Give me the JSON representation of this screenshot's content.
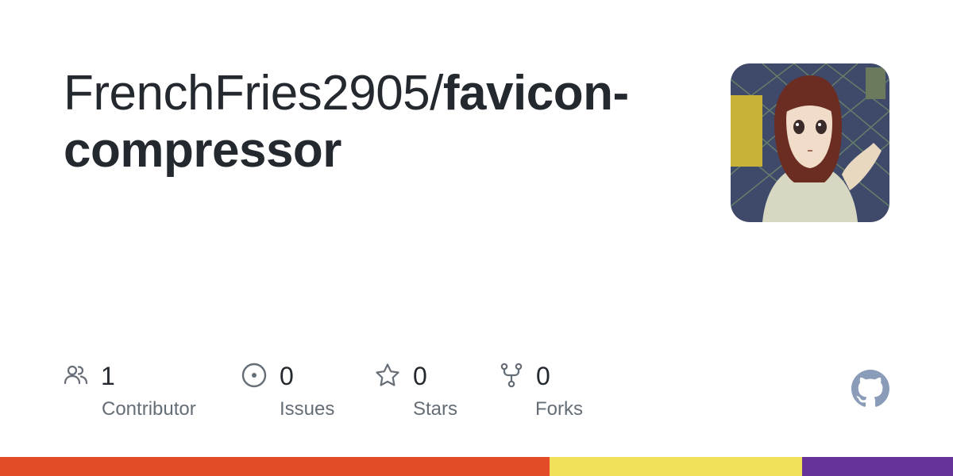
{
  "repo": {
    "owner": "FrenchFries2905/",
    "name_part1": "favicon-",
    "name_part2": "compressor"
  },
  "avatar": {
    "icon": "avatar-anime-character"
  },
  "stats": [
    {
      "icon": "people-icon",
      "count": "1",
      "label": "Contributor"
    },
    {
      "icon": "issue-icon",
      "count": "0",
      "label": "Issues"
    },
    {
      "icon": "star-icon",
      "count": "0",
      "label": "Stars"
    },
    {
      "icon": "fork-icon",
      "count": "0",
      "label": "Forks"
    }
  ],
  "logo": {
    "icon": "github-icon",
    "color": "#8b9cb8"
  },
  "languages": [
    {
      "color": "#e34c26",
      "share": 0.577
    },
    {
      "color": "#f1e05a",
      "share": 0.265
    },
    {
      "color": "#663399",
      "share": 0.158
    }
  ]
}
